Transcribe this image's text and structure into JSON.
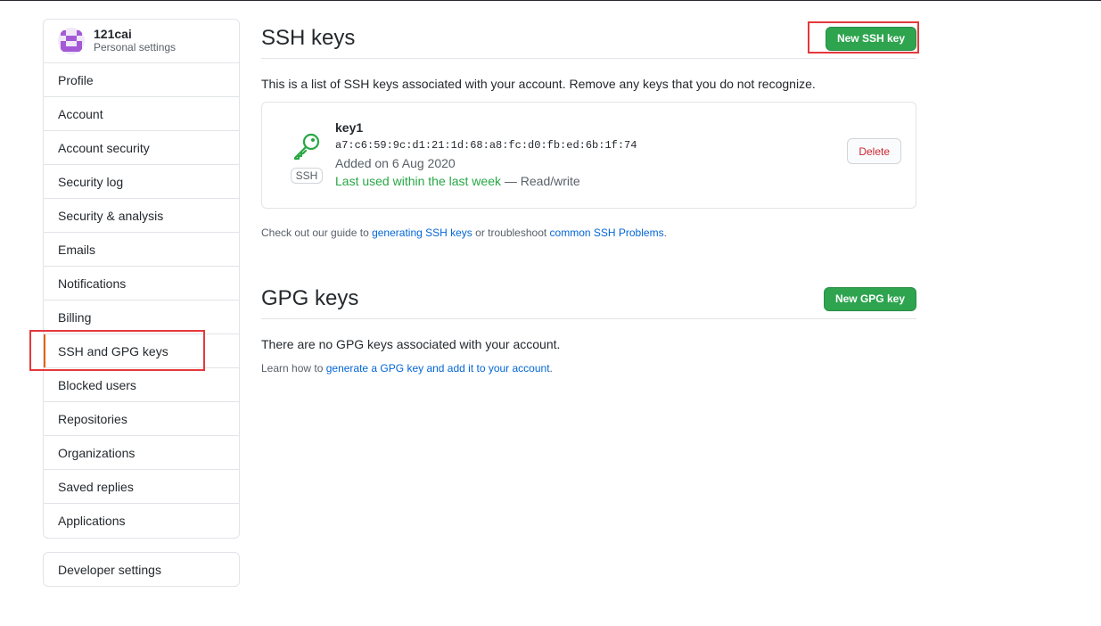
{
  "user": {
    "name": "121cai",
    "subtitle": "Personal settings"
  },
  "sidebar": {
    "items": [
      {
        "label": "Profile"
      },
      {
        "label": "Account"
      },
      {
        "label": "Account security"
      },
      {
        "label": "Security log"
      },
      {
        "label": "Security & analysis"
      },
      {
        "label": "Emails"
      },
      {
        "label": "Notifications"
      },
      {
        "label": "Billing"
      },
      {
        "label": "SSH and GPG keys",
        "selected": true
      },
      {
        "label": "Blocked users"
      },
      {
        "label": "Repositories"
      },
      {
        "label": "Organizations"
      },
      {
        "label": "Saved replies"
      },
      {
        "label": "Applications"
      }
    ],
    "developer_settings": "Developer settings"
  },
  "ssh": {
    "title": "SSH keys",
    "new_button": "New SSH key",
    "description": "This is a list of SSH keys associated with your account. Remove any keys that you do not recognize.",
    "key": {
      "icon": "key-icon",
      "badge": "SSH",
      "title": "key1",
      "fingerprint": "a7:c6:59:9c:d1:21:1d:68:a8:fc:d0:fb:ed:6b:1f:74",
      "added": "Added on 6 Aug 2020",
      "last_used": "Last used within the last week",
      "access": " — Read/write",
      "delete_label": "Delete"
    },
    "guide": {
      "prefix": "Check out our guide to ",
      "link1": "generating SSH keys",
      "middle": " or troubleshoot ",
      "link2": "common SSH Problems",
      "suffix": "."
    }
  },
  "gpg": {
    "title": "GPG keys",
    "new_button": "New GPG key",
    "empty": "There are no GPG keys associated with your account.",
    "learn_prefix": "Learn how to ",
    "learn_link": "generate a GPG key and add it to your account",
    "learn_suffix": "."
  },
  "colors": {
    "accent_green": "#2ea44f",
    "highlight_red": "#e5383b",
    "link_blue": "#0366d6",
    "danger": "#cb2431"
  }
}
